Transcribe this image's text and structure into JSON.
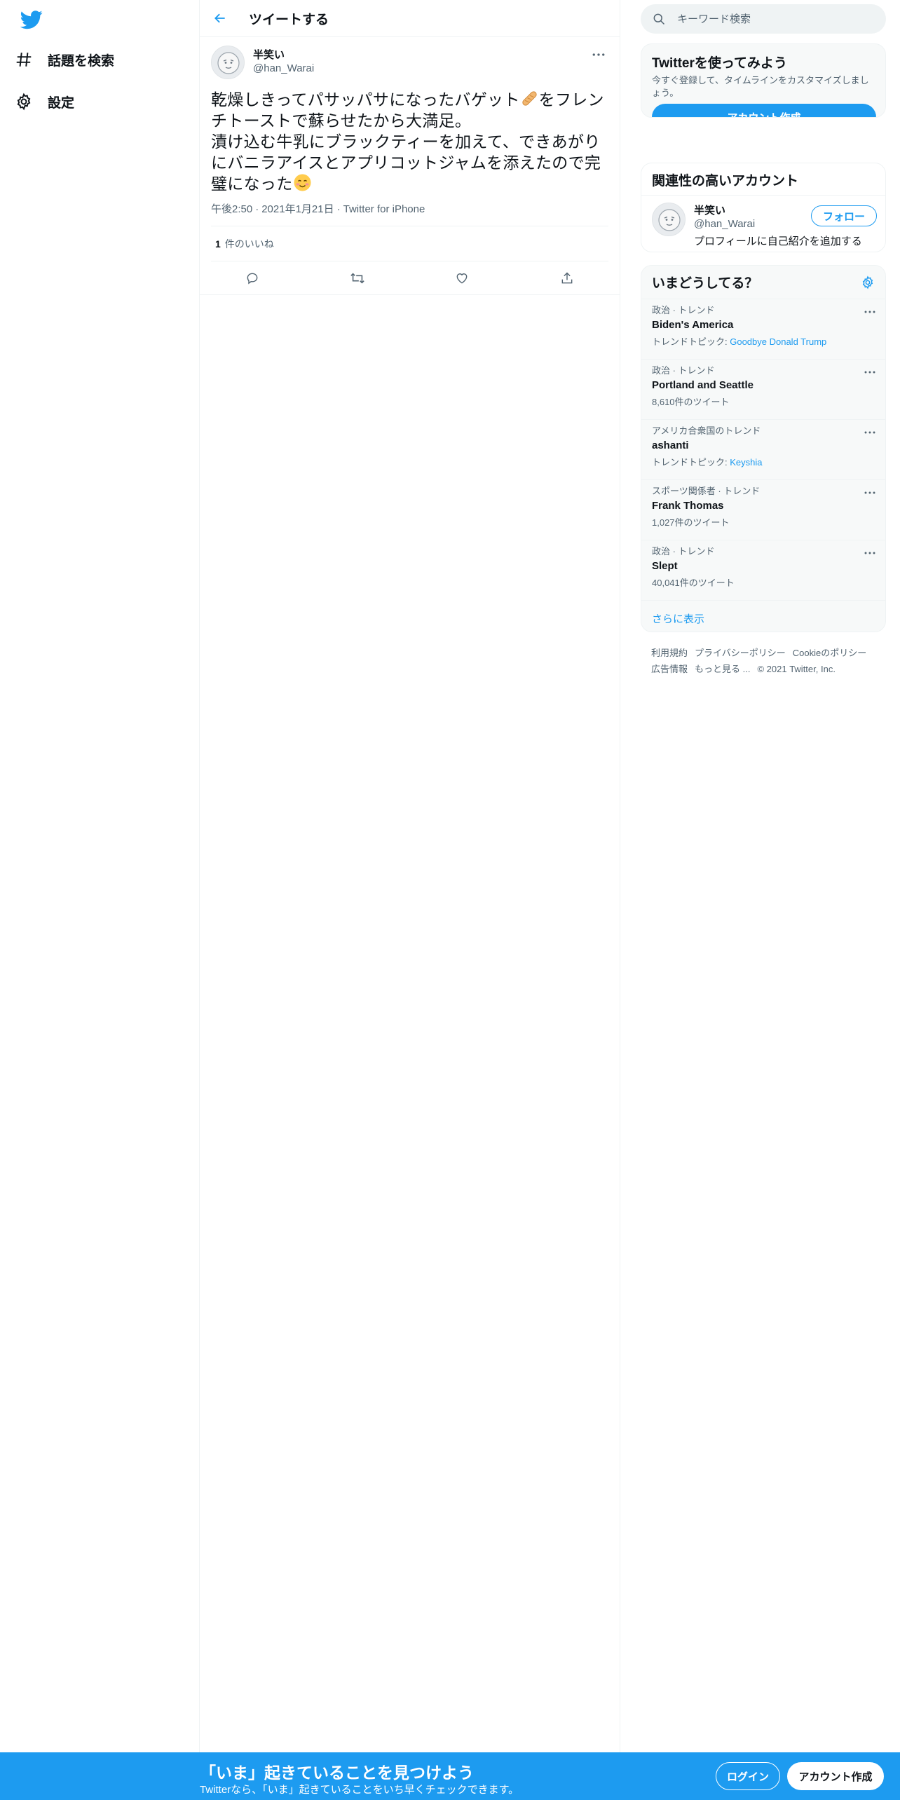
{
  "colors": {
    "accent": "#1d9bf0",
    "text": "#0f1419",
    "secondary": "#536471"
  },
  "sidebar": {
    "logo_icon": "twitter-bird-icon",
    "items": [
      {
        "icon": "hashtag-icon",
        "label": "話題を検索"
      },
      {
        "icon": "gear-icon",
        "label": "設定"
      }
    ]
  },
  "header": {
    "title": "ツイートする",
    "back_icon": "arrow-left-icon"
  },
  "tweet": {
    "user_name": "半笑い",
    "handle": "@han_Warai",
    "text_part1": "乾燥しきってパサッパサになったバゲット",
    "emoji1": "baguette-emoji",
    "text_part2": "をフレンチトーストで蘇らせたから大満足。\n漬け込む牛乳にブラックティーを加えて、できあがりにバニラアイスとアプリコットジャムを添えたので完璧になった",
    "emoji2": "smiling-face-emoji",
    "time": "午後2:50",
    "date": "2021年1月21日",
    "source": "Twitter for iPhone",
    "separator": "·",
    "likes_count": "1",
    "likes_label": "件のいいね"
  },
  "search": {
    "placeholder": "キーワード検索"
  },
  "signup_card": {
    "title": "Twitterを使ってみよう",
    "subtitle": "今すぐ登録して、タイムラインをカスタマイズしましょう。",
    "button": "アカウント作成"
  },
  "related": {
    "title": "関連性の高いアカウント",
    "user_name": "半笑い",
    "handle": "@han_Warai",
    "follow": "フォロー",
    "bio": "プロフィールに自己紹介を追加する"
  },
  "trends": {
    "title": "いまどうしてる？",
    "items": [
      {
        "context": "政治 · トレンド",
        "name": "Biden's America",
        "sub_prefix": "トレンドトピック: ",
        "sub_link": "Goodbye Donald Trump",
        "sub": ""
      },
      {
        "context": "政治 · トレンド",
        "name": "Portland and Seattle",
        "sub_prefix": "",
        "sub_link": "",
        "sub": "8,610件のツイート"
      },
      {
        "context": "アメリカ合衆国のトレンド",
        "name": "ashanti",
        "sub_prefix": "トレンドトピック: ",
        "sub_link": "Keyshia",
        "sub": ""
      },
      {
        "context": "スポーツ関係者 · トレンド",
        "name": "Frank Thomas",
        "sub_prefix": "",
        "sub_link": "",
        "sub": "1,027件のツイート"
      },
      {
        "context": "政治 · トレンド",
        "name": "Slept",
        "sub_prefix": "",
        "sub_link": "",
        "sub": "40,041件のツイート"
      }
    ],
    "show_more": "さらに表示"
  },
  "footer": {
    "terms": "利用規約",
    "privacy": "プライバシーポリシー",
    "cookie": "Cookieのポリシー",
    "ads": "広告情報",
    "more": "もっと見る ...",
    "copyright": "© 2021 Twitter, Inc."
  },
  "bottom_bar": {
    "title": "「いま」起きていることを見つけよう",
    "subtitle": "Twitterなら、「いま」起きていることをいち早くチェックできます。",
    "login": "ログイン",
    "signup": "アカウント作成"
  }
}
